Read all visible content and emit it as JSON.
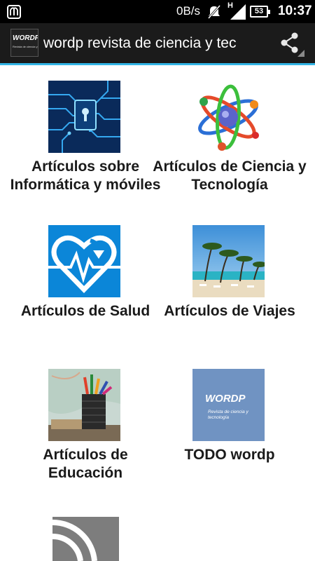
{
  "status_bar": {
    "network_speed": "0B/s",
    "network_type": "H",
    "battery": "53",
    "time": "10:37",
    "icons": [
      "app-notification-icon",
      "mute-icon",
      "signal-icon",
      "battery-icon"
    ]
  },
  "action_bar": {
    "logo_text": "WORDP",
    "logo_subtext": "Revista de ciencia y",
    "title": "wordp revista de ciencia y tec",
    "share_icon": "share-icon",
    "accent": "#33b5e5"
  },
  "grid": {
    "items": [
      {
        "label": "Artículos sobre Informática y móviles",
        "icon": "circuit-lock-thumb"
      },
      {
        "label": "Artículos de Ciencia y Tecnología",
        "icon": "atom-thumb"
      },
      {
        "label": "Artículos de Salud",
        "icon": "heart-pulse-thumb"
      },
      {
        "label": "Artículos de Viajes",
        "icon": "beach-thumb"
      },
      {
        "label": "Artículos de Educación",
        "icon": "pencils-thumb"
      },
      {
        "label": "TODO wordp",
        "icon": "wordp-logo-thumb",
        "thumb_title": "WORDP",
        "thumb_subtitle": "Revista de ciencia y tecnología"
      },
      {
        "label": "",
        "icon": "rss-feed-thumb"
      }
    ]
  }
}
